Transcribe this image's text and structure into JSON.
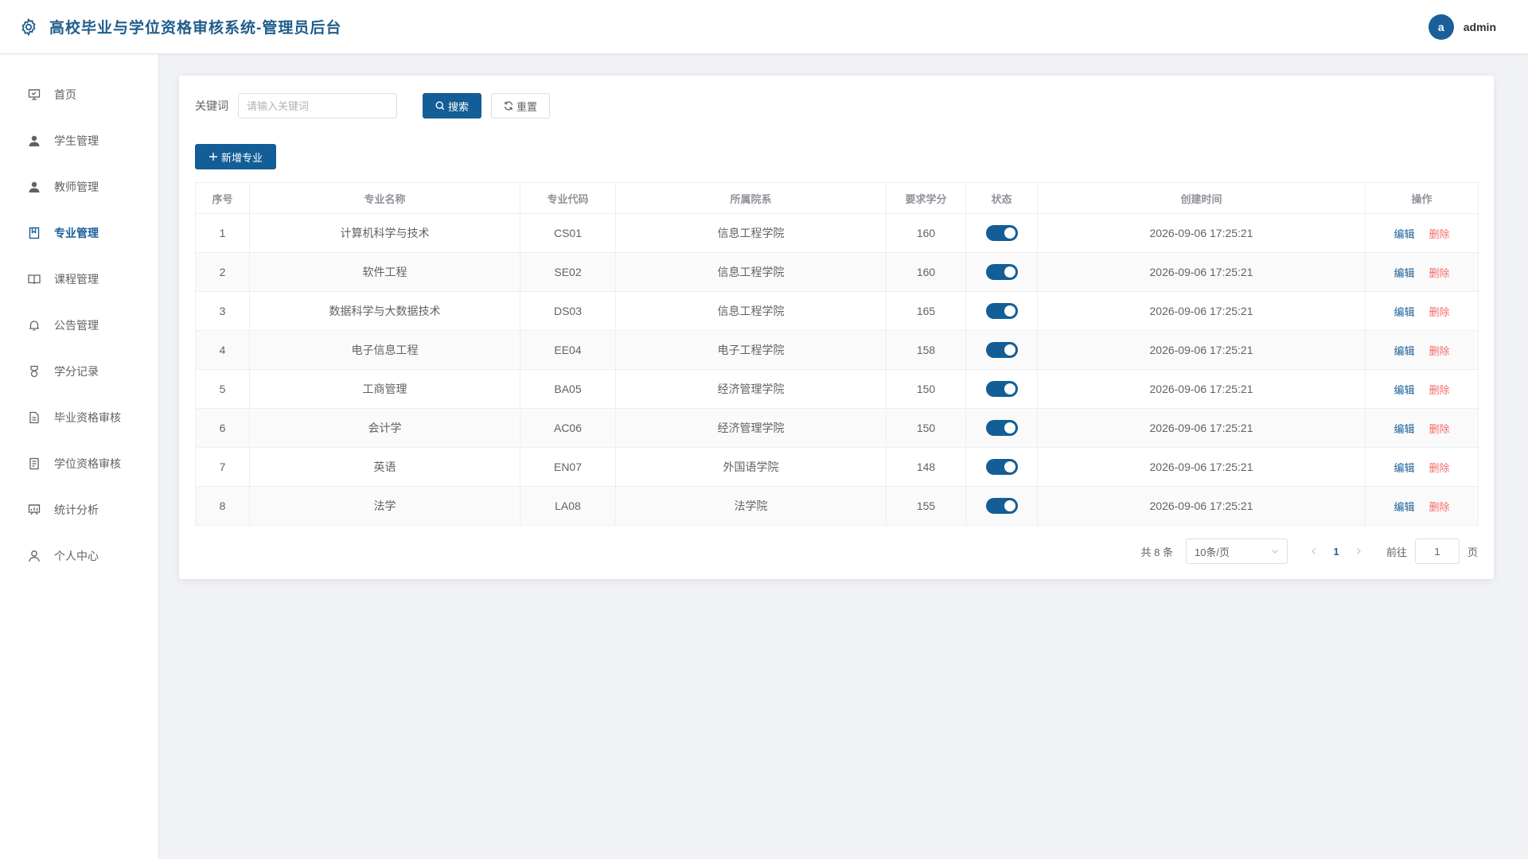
{
  "header": {
    "title": "高校毕业与学位资格审核系统-管理员后台",
    "avatar_letter": "a",
    "username": "admin"
  },
  "sidebar": {
    "items": [
      {
        "label": "首页",
        "icon": "presentation-icon",
        "active": false
      },
      {
        "label": "学生管理",
        "icon": "user-icon",
        "active": false
      },
      {
        "label": "教师管理",
        "icon": "user-icon",
        "active": false
      },
      {
        "label": "专业管理",
        "icon": "notebook-icon",
        "active": true
      },
      {
        "label": "课程管理",
        "icon": "book-open-icon",
        "active": false
      },
      {
        "label": "公告管理",
        "icon": "bell-icon",
        "active": false
      },
      {
        "label": "学分记录",
        "icon": "medal-icon",
        "active": false
      },
      {
        "label": "毕业资格审核",
        "icon": "document-icon",
        "active": false
      },
      {
        "label": "学位资格审核",
        "icon": "tickets-icon",
        "active": false
      },
      {
        "label": "统计分析",
        "icon": "data-board-icon",
        "active": false
      },
      {
        "label": "个人中心",
        "icon": "user-outline-icon",
        "active": false
      }
    ]
  },
  "search": {
    "keyword_label": "关键词",
    "keyword_placeholder": "请输入关键词",
    "keyword_value": "",
    "search_label": "搜索",
    "reset_label": "重置"
  },
  "toolbar": {
    "add_label": "新增专业"
  },
  "table": {
    "columns": [
      "序号",
      "专业名称",
      "专业代码",
      "所属院系",
      "要求学分",
      "状态",
      "创建时间",
      "操作"
    ],
    "rows": [
      {
        "index": "1",
        "name": "计算机科学与技术",
        "code": "CS01",
        "dept": "信息工程学院",
        "credits": "160",
        "enabled": true,
        "created": "2026-09-06 17:25:21"
      },
      {
        "index": "2",
        "name": "软件工程",
        "code": "SE02",
        "dept": "信息工程学院",
        "credits": "160",
        "enabled": true,
        "created": "2026-09-06 17:25:21"
      },
      {
        "index": "3",
        "name": "数据科学与大数据技术",
        "code": "DS03",
        "dept": "信息工程学院",
        "credits": "165",
        "enabled": true,
        "created": "2026-09-06 17:25:21"
      },
      {
        "index": "4",
        "name": "电子信息工程",
        "code": "EE04",
        "dept": "电子工程学院",
        "credits": "158",
        "enabled": true,
        "created": "2026-09-06 17:25:21"
      },
      {
        "index": "5",
        "name": "工商管理",
        "code": "BA05",
        "dept": "经济管理学院",
        "credits": "150",
        "enabled": true,
        "created": "2026-09-06 17:25:21"
      },
      {
        "index": "6",
        "name": "会计学",
        "code": "AC06",
        "dept": "经济管理学院",
        "credits": "150",
        "enabled": true,
        "created": "2026-09-06 17:25:21"
      },
      {
        "index": "7",
        "name": "英语",
        "code": "EN07",
        "dept": "外国语学院",
        "credits": "148",
        "enabled": true,
        "created": "2026-09-06 17:25:21"
      },
      {
        "index": "8",
        "name": "法学",
        "code": "LA08",
        "dept": "法学院",
        "credits": "155",
        "enabled": true,
        "created": "2026-09-06 17:25:21"
      }
    ],
    "edit_label": "编辑",
    "delete_label": "删除"
  },
  "pagination": {
    "total_text": "共 8 条",
    "page_size": "10条/页",
    "current_page": "1",
    "goto_label": "前往",
    "goto_value": "1",
    "goto_suffix": "页"
  },
  "colors": {
    "primary": "#135e96",
    "danger": "#f56c6c",
    "background": "#f0f2f5"
  }
}
